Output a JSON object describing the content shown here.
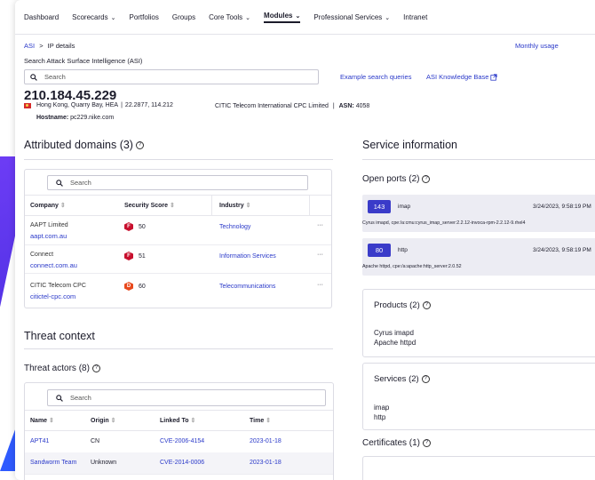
{
  "nav": {
    "items": [
      {
        "label": "Dashboard",
        "chevron": false,
        "active": false
      },
      {
        "label": "Scorecards",
        "chevron": true,
        "active": false
      },
      {
        "label": "Portfolios",
        "chevron": false,
        "active": false
      },
      {
        "label": "Groups",
        "chevron": false,
        "active": false
      },
      {
        "label": "Core Tools",
        "chevron": true,
        "active": false
      },
      {
        "label": "Modules",
        "chevron": true,
        "active": true
      },
      {
        "label": "Professional Services",
        "chevron": true,
        "active": false
      },
      {
        "label": "Intranet",
        "chevron": false,
        "active": false
      }
    ]
  },
  "breadcrumb": {
    "root": "ASI",
    "separator": ">",
    "current": "IP details"
  },
  "monthly_usage": "Monthly usage",
  "asi": {
    "label": "Search Attack Surface Intelligence (ASI)",
    "placeholder": "Search",
    "example_queries": "Example search queries",
    "knowledge_base": "ASI Knowledge Base"
  },
  "ip": {
    "address": "210.184.45.229",
    "location": "Hong Kong, Quarry Bay, HEA",
    "coords": "22.2877, 114.212",
    "org": "CITIC Telecom International CPC Limited",
    "asn_label": "ASN:",
    "asn": "4058",
    "hostname_label": "Hostname:",
    "hostname": "pc229.nike.com"
  },
  "domains": {
    "title": "Attributed domains (3)",
    "search_placeholder": "Search",
    "headers": [
      "Company",
      "Security Score",
      "Industry"
    ],
    "rows": [
      {
        "company": "AAPT Limited",
        "domain": "aapt.com.au",
        "grade": "F",
        "score": "50",
        "industry": "Technology",
        "color": "#c8102e"
      },
      {
        "company": "Connect",
        "domain": "connect.com.au",
        "grade": "F",
        "score": "51",
        "industry": "Information Services",
        "color": "#c8102e"
      },
      {
        "company": "CITIC Telecom CPC",
        "domain": "citictel-cpc.com",
        "grade": "D",
        "score": "60",
        "industry": "Telecommunications",
        "color": "#e8491d"
      }
    ],
    "more": "···"
  },
  "threat": {
    "title": "Threat context",
    "actors_title": "Threat actors (8)",
    "search_placeholder": "Search",
    "headers": [
      "Name",
      "Origin",
      "Linked To",
      "Time"
    ],
    "rows": [
      {
        "name": "APT41",
        "origin": "CN",
        "linked": "CVE-2006-4154",
        "time": "2023-01-18"
      },
      {
        "name": "Sandworm Team",
        "origin": "Unknown",
        "linked": "CVE-2014-0006",
        "time": "2023-01-18"
      }
    ]
  },
  "service": {
    "title": "Service information",
    "open_ports_title": "Open ports (2)",
    "ports": [
      {
        "port": "143",
        "name": "imap",
        "time": "3/24/2023, 9:58:19 PM",
        "detail": "Cyrus imapd, cpe:/a:cmu:cyrus_imap_server:2.2.12-invoca-rpm-2.2.12-9.rhel4"
      },
      {
        "port": "80",
        "name": "http",
        "time": "3/24/2023, 9:58:19 PM",
        "detail": "Apache httpd, cpe:/a:apache:http_server:2.0.52"
      }
    ],
    "products_title": "Products (2)",
    "products": [
      "Cyrus imapd",
      "Apache httpd"
    ],
    "services_title": "Services (2)",
    "services": [
      "imap",
      "http"
    ],
    "certificates_title": "Certificates (1)"
  }
}
